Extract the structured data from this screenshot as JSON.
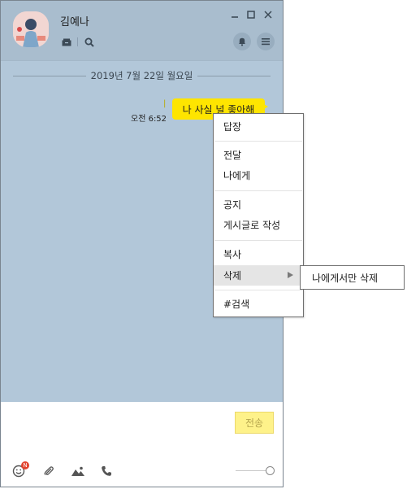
{
  "chat": {
    "contact_name": "김예나",
    "date_divider": "2019년 7월 22일 월요일",
    "message": {
      "text": "나 사실 널 좋아해",
      "time": "오전 6:52"
    }
  },
  "composer": {
    "send_label": "전송",
    "emoji_badge": "N"
  },
  "context_menu": {
    "reply": "답장",
    "forward": "전달",
    "to_me": "나에게",
    "notice": "공지",
    "post": "게시글로 작성",
    "copy": "복사",
    "delete": "삭제",
    "search": "#검색"
  },
  "submenu": {
    "delete_for_me": "나에게서만 삭제"
  },
  "colors": {
    "chat_bg": "#b2c7d9",
    "bubble": "#fee500",
    "badge": "#e2442f"
  }
}
